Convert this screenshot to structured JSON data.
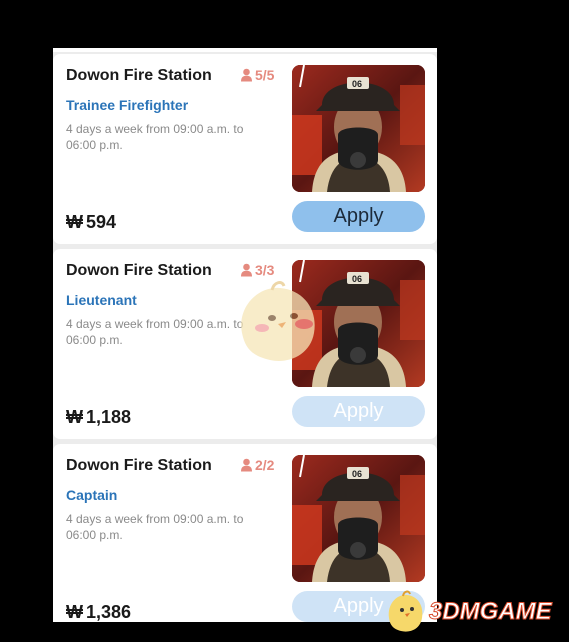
{
  "jobs": [
    {
      "station": "Dowon Fire Station",
      "slots": "5/5",
      "role": "Trainee Firefighter",
      "hours": "4 days a week from 09:00 a.m. to 06:00 p.m.",
      "currency_symbol": "₩",
      "wage": "594",
      "apply_label": "Apply",
      "apply_enabled": true,
      "thumbnail_icon": "firefighter-portrait",
      "helmet_number": "06"
    },
    {
      "station": "Dowon Fire Station",
      "slots": "3/3",
      "role": "Lieutenant",
      "hours": "4 days a week from 09:00 a.m. to 06:00 p.m.",
      "currency_symbol": "₩",
      "wage": "1,188",
      "apply_label": "Apply",
      "apply_enabled": false,
      "thumbnail_icon": "firefighter-portrait",
      "helmet_number": "06"
    },
    {
      "station": "Dowon Fire Station",
      "slots": "2/2",
      "role": "Captain",
      "hours": "4 days a week from 09:00 a.m. to 06:00 p.m.",
      "currency_symbol": "₩",
      "wage": "1,386",
      "apply_label": "Apply",
      "apply_enabled": false,
      "thumbnail_icon": "firefighter-portrait",
      "helmet_number": "06"
    }
  ],
  "watermark": {
    "text": "3DMGAME"
  },
  "colors": {
    "role_text": "#2b74b8",
    "slots_text": "#e58a7f",
    "apply_active": "#8fc0ec",
    "apply_disabled": "#cfe3f6"
  }
}
